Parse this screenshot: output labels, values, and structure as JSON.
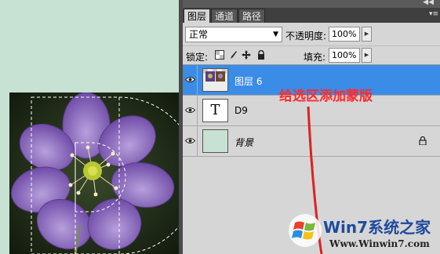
{
  "panel": {
    "tabs": [
      {
        "label": "图层",
        "active": true
      },
      {
        "label": "通道",
        "active": false
      },
      {
        "label": "路径",
        "active": false
      }
    ],
    "collapse_icon": "double-chevron-icon",
    "menu_icon": "panel-menu-icon"
  },
  "blend": {
    "mode": "正常",
    "opacity_label": "不透明度:",
    "opacity_value": "100%"
  },
  "lock": {
    "label": "锁定:",
    "icons": [
      "lock-transparent-icon",
      "lock-paint-icon",
      "lock-move-icon",
      "lock-all-icon"
    ],
    "fill_label": "填充:",
    "fill_value": "100%"
  },
  "layers": [
    {
      "name": "图层 6",
      "selected": true,
      "thumb": "image-with-mask"
    },
    {
      "name": "D9",
      "selected": false,
      "thumb": "text"
    },
    {
      "name": "背景",
      "selected": false,
      "thumb": "solid",
      "locked": true
    }
  ],
  "colors": {
    "selected_row": "#3b8ce6",
    "background_swatch": "#c7e1d2",
    "annotation": "#ff2a2a"
  },
  "annotation": {
    "text": "给选区添加蒙版"
  },
  "watermark": {
    "brand": "Win7系统之家",
    "url": "Www.Winwin7.com"
  }
}
